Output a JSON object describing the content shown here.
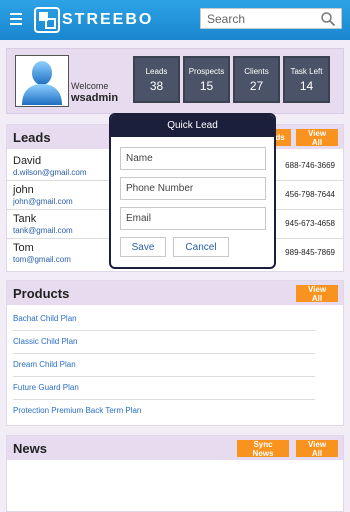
{
  "app": {
    "brand": "STREEBO",
    "menu_icon": "hamburger-menu-icon",
    "logo_icon": "streebo-logo-icon",
    "search_placeholder": "Search",
    "search_icon": "search-icon"
  },
  "profile": {
    "avatar_icon": "user-avatar-icon",
    "welcome": "Welcome",
    "username": "wsadmin",
    "stats": [
      {
        "label": "Leads",
        "value": "38"
      },
      {
        "label": "Prospects",
        "value": "15"
      },
      {
        "label": "Clients",
        "value": "27"
      },
      {
        "label": "Task Left",
        "value": "14"
      }
    ]
  },
  "leads": {
    "title": "Leads",
    "add_partial": "ds",
    "view_all": "View All",
    "rows": [
      {
        "name": "David",
        "email": "d.wilson@gmail.com",
        "phone": "688-746-3669"
      },
      {
        "name": "john",
        "email": "john@gmail.com",
        "phone": "456-798-7644"
      },
      {
        "name": "Tank",
        "email": "tank@gmail.com",
        "phone": "945-673-4658"
      },
      {
        "name": "Tom",
        "email": "tom@gmail.com",
        "phone": "989-845-7869"
      }
    ]
  },
  "products": {
    "title": "Products",
    "view_all": "View All",
    "items": [
      "Bachat Child Plan",
      "Classic Child Plan",
      "Dream Child Plan",
      "Future Guard Plan",
      "Protection Premium Back Term Plan"
    ]
  },
  "news": {
    "title": "News",
    "sync": "Sync News",
    "view_all": "View All"
  },
  "quick_lead": {
    "title": "Quick Lead",
    "name_placeholder": "Name",
    "phone_placeholder": "Phone Number",
    "email_placeholder": "Email",
    "save": "Save",
    "cancel": "Cancel"
  },
  "colors": {
    "topbar": "#1f8fd8",
    "accent_orange": "#f7931e",
    "stat_tile": "#4a5367",
    "modal_header": "#1b1f3b",
    "link_blue": "#2a6fc7"
  }
}
